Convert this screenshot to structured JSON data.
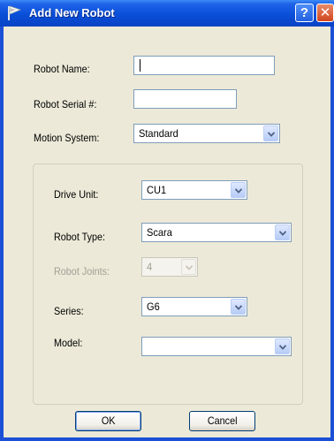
{
  "window": {
    "title": "Add New Robot"
  },
  "fields": {
    "robot_name": {
      "label": "Robot Name:",
      "value": ""
    },
    "robot_serial": {
      "label": "Robot Serial #:",
      "value": ""
    },
    "motion_system": {
      "label": "Motion System:",
      "value": "Standard"
    }
  },
  "group": {
    "drive_unit": {
      "label": "Drive Unit:",
      "value": "CU1"
    },
    "robot_type": {
      "label": "Robot Type:",
      "value": "Scara"
    },
    "robot_joints": {
      "label": "Robot Joints:",
      "value": "4",
      "enabled": false
    },
    "series": {
      "label": "Series:",
      "value": "G6"
    },
    "model": {
      "label": "Model:",
      "value": ""
    }
  },
  "buttons": {
    "ok": "OK",
    "cancel": "Cancel"
  },
  "icons": {
    "app": "robot-flag-icon",
    "help": "help-icon",
    "close": "close-icon",
    "dropdown": "chevron-down-icon"
  },
  "colors": {
    "titlebar": "#0a4fd8",
    "dialog_bg": "#ece9d8",
    "close_button": "#d1461c",
    "input_border": "#7f9db9"
  }
}
